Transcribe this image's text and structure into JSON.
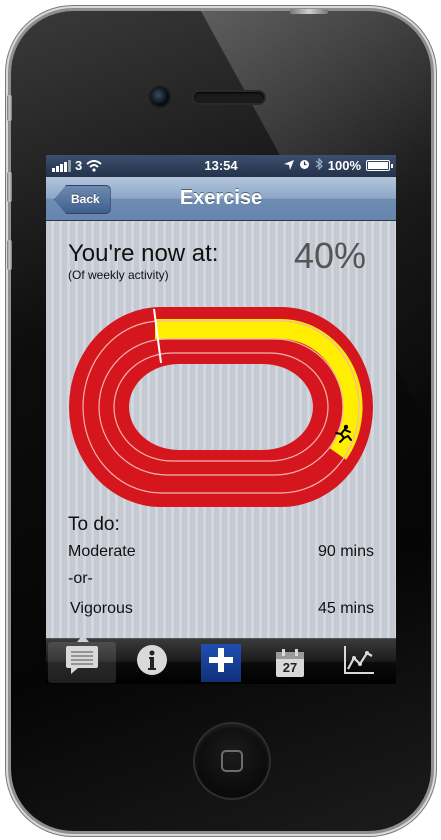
{
  "status_bar": {
    "carrier": "3",
    "time": "13:54",
    "battery": "100%"
  },
  "nav": {
    "back_label": "Back",
    "title": "Exercise"
  },
  "progress": {
    "headline": "You're now at:",
    "subline": "(Of weekly activity)",
    "percent_label": "40%",
    "fraction": 0.4
  },
  "todo": {
    "title": "To do:",
    "moderate_label": "Moderate",
    "moderate_value": "90 mins",
    "or_label": "-or-",
    "vigorous_label": "Vigorous",
    "vigorous_value": "45 mins"
  },
  "tabs": {
    "items": [
      "notes-icon",
      "info-icon",
      "add-icon",
      "calendar-icon",
      "chart-icon"
    ],
    "calendar_day": "27",
    "active_index": 0
  },
  "colors": {
    "track_red": "#d6161f",
    "progress_yellow": "#ffee00",
    "tab_add_blue": "#1f4fb3"
  }
}
